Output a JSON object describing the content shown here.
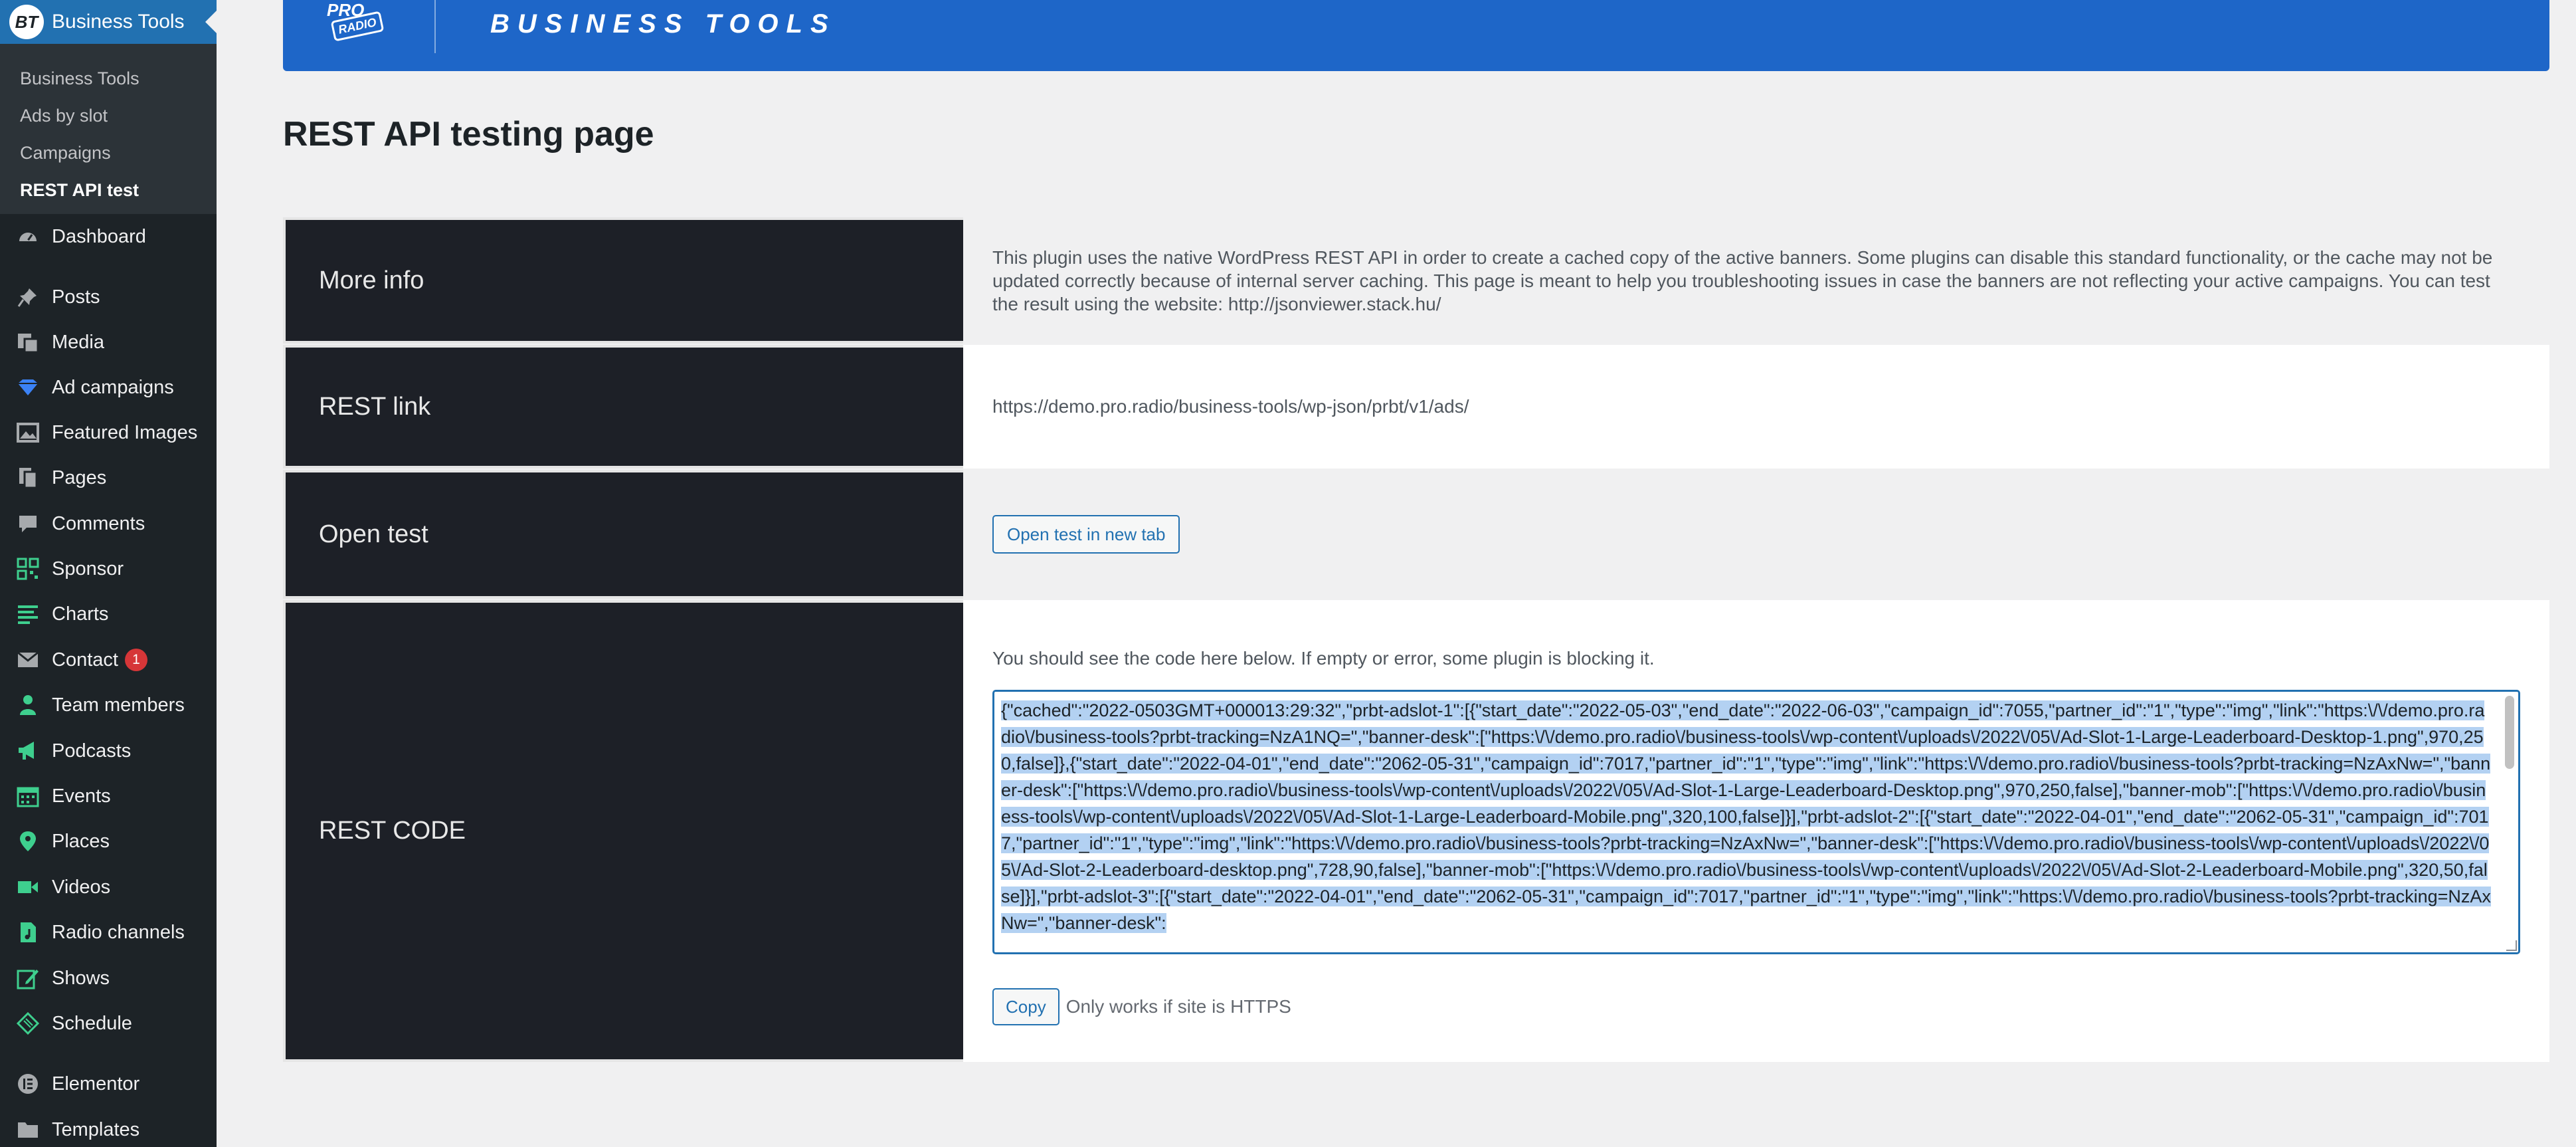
{
  "sidebar": {
    "active": {
      "icon": "business-tools-logo",
      "logo_text": "BT",
      "label": "Business Tools"
    },
    "submenu": [
      "Business Tools",
      "Ads by slot",
      "Campaigns",
      "REST API test"
    ],
    "items": [
      {
        "label": "Dashboard",
        "icon": "dashboard-icon"
      },
      {
        "label": "Posts",
        "icon": "pushpin-icon"
      },
      {
        "label": "Media",
        "icon": "media-icon"
      },
      {
        "label": "Ad campaigns",
        "icon": "diamond-icon"
      },
      {
        "label": "Featured Images",
        "icon": "image-icon"
      },
      {
        "label": "Pages",
        "icon": "pages-icon"
      },
      {
        "label": "Comments",
        "icon": "comment-icon"
      },
      {
        "label": "Sponsor",
        "icon": "grid-icon"
      },
      {
        "label": "Charts",
        "icon": "list-icon"
      },
      {
        "label": "Contact",
        "icon": "mail-icon",
        "badge": "1"
      },
      {
        "label": "Team members",
        "icon": "person-icon"
      },
      {
        "label": "Podcasts",
        "icon": "megaphone-icon"
      },
      {
        "label": "Events",
        "icon": "calendar-icon"
      },
      {
        "label": "Places",
        "icon": "location-icon"
      },
      {
        "label": "Videos",
        "icon": "video-icon"
      },
      {
        "label": "Radio channels",
        "icon": "audio-icon"
      },
      {
        "label": "Shows",
        "icon": "edit-icon"
      },
      {
        "label": "Schedule",
        "icon": "ticket-icon"
      },
      {
        "label": "Elementor",
        "icon": "elementor-icon"
      },
      {
        "label": "Templates",
        "icon": "folder-icon"
      }
    ]
  },
  "banner": {
    "logo_line1": "PRO",
    "logo_line2": "RADIO",
    "title": "BUSINESS TOOLS"
  },
  "page": {
    "title": "REST API testing page"
  },
  "rows": {
    "more_info": {
      "label": "More info",
      "text": "This plugin uses the native WordPress REST API in order to create a cached copy of the active banners. Some plugins can disable this standard functionality, or the cache may not be updated correctly because of internal server caching. This page is meant to help you troubleshooting issues in case the banners are not reflecting your active campaigns. You can test the result using the website: http://jsonviewer.stack.hu/"
    },
    "rest_link": {
      "label": "REST link",
      "url": "https://demo.pro.radio/business-tools/wp-json/prbt/v1/ads/"
    },
    "open_test": {
      "label": "Open test",
      "button": "Open test in new tab"
    },
    "rest_code": {
      "label": "REST CODE",
      "intro": "You should see the code here below. If empty or error, some plugin is blocking it.",
      "code": "{\"cached\":\"2022-0503GMT+000013:29:32\",\"prbt-adslot-1\":[{\"start_date\":\"2022-05-03\",\"end_date\":\"2022-06-03\",\"campaign_id\":7055,\"partner_id\":\"1\",\"type\":\"img\",\"link\":\"https:\\/\\/demo.pro.radio\\/business-tools?prbt-tracking=NzA1NQ=\",\"banner-desk\":[\"https:\\/\\/demo.pro.radio\\/business-tools\\/wp-content\\/uploads\\/2022\\/05\\/Ad-Slot-1-Large-Leaderboard-Desktop-1.png\",970,250,false]},{\"start_date\":\"2022-04-01\",\"end_date\":\"2062-05-31\",\"campaign_id\":7017,\"partner_id\":\"1\",\"type\":\"img\",\"link\":\"https:\\/\\/demo.pro.radio\\/business-tools?prbt-tracking=NzAxNw=\",\"banner-desk\":[\"https:\\/\\/demo.pro.radio\\/business-tools\\/wp-content\\/uploads\\/2022\\/05\\/Ad-Slot-1-Large-Leaderboard-Desktop.png\",970,250,false],\"banner-mob\":[\"https:\\/\\/demo.pro.radio\\/business-tools\\/wp-content\\/uploads\\/2022\\/05\\/Ad-Slot-1-Large-Leaderboard-Mobile.png\",320,100,false]}],\"prbt-adslot-2\":[{\"start_date\":\"2022-04-01\",\"end_date\":\"2062-05-31\",\"campaign_id\":7017,\"partner_id\":\"1\",\"type\":\"img\",\"link\":\"https:\\/\\/demo.pro.radio\\/business-tools?prbt-tracking=NzAxNw=\",\"banner-desk\":[\"https:\\/\\/demo.pro.radio\\/business-tools\\/wp-content\\/uploads\\/2022\\/05\\/Ad-Slot-2-Leaderboard-desktop.png\",728,90,false],\"banner-mob\":[\"https:\\/\\/demo.pro.radio\\/business-tools\\/wp-content\\/uploads\\/2022\\/05\\/Ad-Slot-2-Leaderboard-Mobile.png\",320,50,false]}],\"prbt-adslot-3\":[{\"start_date\":\"2022-04-01\",\"end_date\":\"2062-05-31\",\"campaign_id\":7017,\"partner_id\":\"1\",\"type\":\"img\",\"link\":\"https:\\/\\/demo.pro.radio\\/business-tools?prbt-tracking=NzAxNw=\",\"banner-desk\":",
      "copy_button": "Copy",
      "copy_note": "Only works if site is HTTPS"
    }
  },
  "colors": {
    "sidebar": "#1d2327",
    "accent": "#2271b1",
    "banner": "#1e66c8",
    "label_cell": "#1d2027",
    "badge": "#d63638"
  }
}
